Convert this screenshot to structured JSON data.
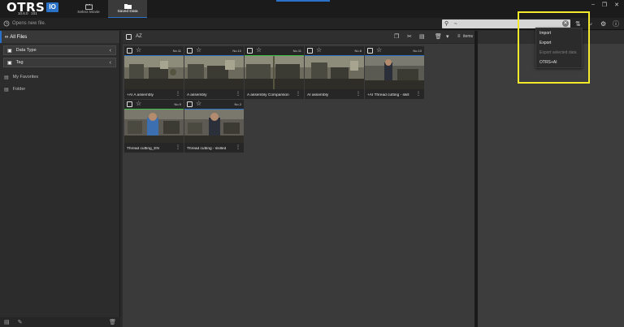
{
  "app": {
    "logo_text": "OTRS",
    "logo_badge": "IO",
    "version_left": "10.6.0",
    "version_right": "101"
  },
  "mode_tabs": [
    {
      "label": "Select Movie",
      "icon": "movie-icon",
      "active": false
    },
    {
      "label": "Saved Data",
      "icon": "folder-icon",
      "active": true
    }
  ],
  "window_controls": [
    "minimize",
    "restore",
    "close"
  ],
  "toolbar": {
    "open_new_label": "Opens new file.",
    "search_placeholder": "Search",
    "search_value": "~"
  },
  "sidebar": {
    "all_files_label": "All Files",
    "groups": [
      {
        "label": "Data Type",
        "icon": "data-type-icon"
      },
      {
        "label": "Tag",
        "icon": "tag-icon"
      }
    ],
    "items": [
      {
        "label": "My Favorites",
        "icon": "favorites-folder-icon"
      },
      {
        "label": "Folder",
        "icon": "folder-icon"
      }
    ]
  },
  "content_toolbar": {
    "sort_label": "AZ",
    "items_label": "items"
  },
  "cards": [
    {
      "no": "No.11",
      "title": "+AI A assembly",
      "bar": "blue"
    },
    {
      "no": "No.10",
      "title": "A assembly",
      "bar": "blue"
    },
    {
      "no": "No.11",
      "title": "A assembly Comparison",
      "bar": "green"
    },
    {
      "no": "No.8",
      "title": "AI assembly",
      "bar": "blue"
    },
    {
      "no": "No.10",
      "title": "+AI Thread cutting - skill",
      "bar": "blue"
    },
    {
      "no": "No.9",
      "title": "Thread cutting_EN",
      "bar": "green"
    },
    {
      "no": "No.3",
      "title": "Thread cutting - skilled",
      "bar": "blue"
    }
  ],
  "dropdown": {
    "items": [
      {
        "label": "Import",
        "enabled": true
      },
      {
        "label": "Export",
        "enabled": true
      },
      {
        "label": "Export selected data",
        "enabled": false
      },
      {
        "label": "OTRS+AI",
        "enabled": true
      }
    ]
  },
  "colors": {
    "accent": "#2a72c8",
    "highlight": "#f3ea2b",
    "green_bar": "#3fbf4a"
  }
}
